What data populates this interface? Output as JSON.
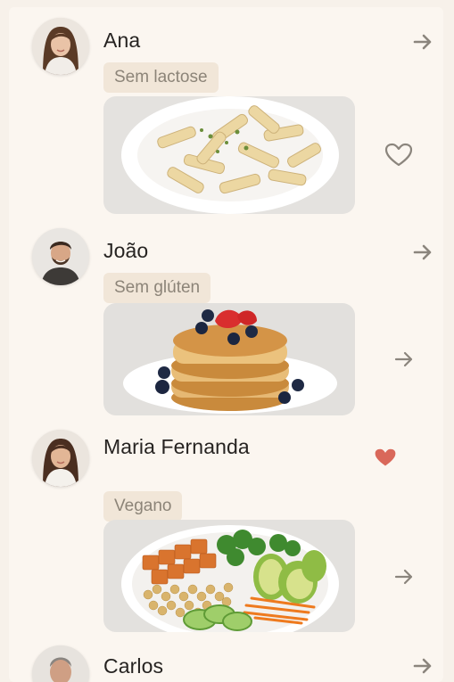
{
  "feed": {
    "items": [
      {
        "name": "Ana",
        "tag": "Sem lactose",
        "dish": "pasta",
        "action": "like",
        "liked": false
      },
      {
        "name": "João",
        "tag": "Sem glúten",
        "dish": "pancakes",
        "action": "open"
      },
      {
        "name": "Maria Fernanda",
        "tag": "Vegano",
        "dish": "bowl",
        "action": "open",
        "liked": true
      },
      {
        "name": "Carlos",
        "tag": "",
        "dish": "",
        "action": "open"
      }
    ]
  },
  "icons": {
    "arrow": "arrow-right-icon",
    "heart_outline": "heart-outline-icon",
    "heart_filled": "heart-filled-icon"
  },
  "colors": {
    "background": "#f7f1ea",
    "tag_bg": "#f1e6d8",
    "tag_text": "#8c8478",
    "heart_liked": "#d9685a",
    "icon": "#8b857d"
  }
}
